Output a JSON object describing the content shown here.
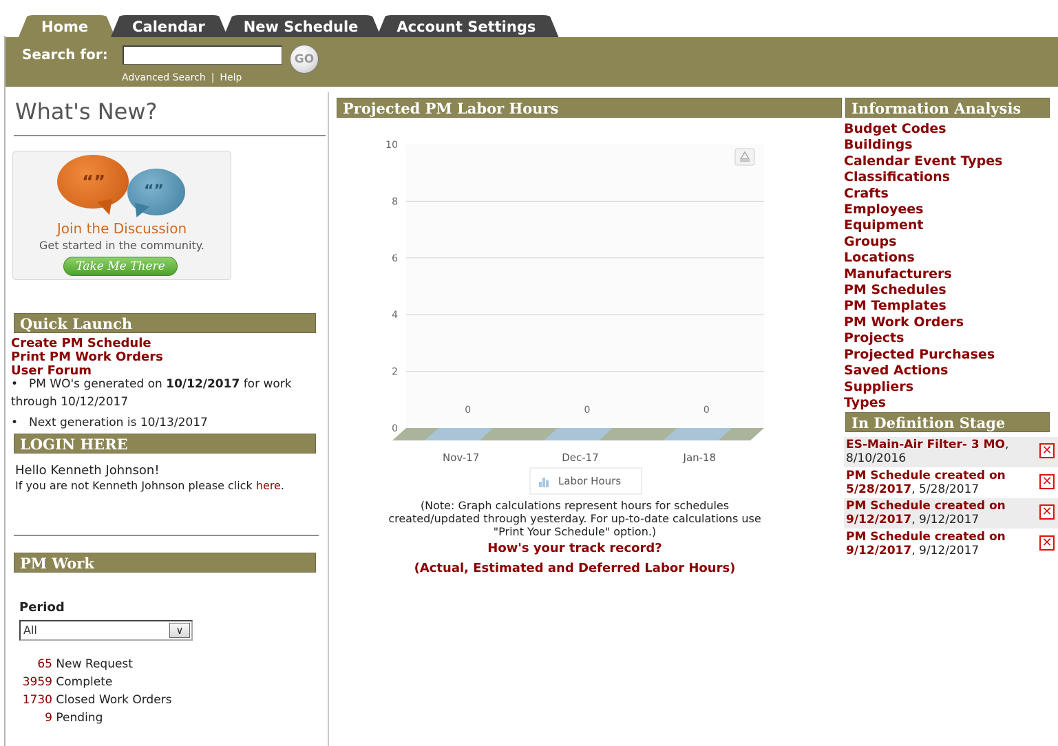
{
  "tabs": [
    "Home",
    "Calendar",
    "New Schedule",
    "Account Settings"
  ],
  "search": {
    "label": "Search for:",
    "value": "",
    "go": "GO",
    "advanced": "Advanced Search",
    "separator": "|",
    "help": "Help"
  },
  "whats_new": {
    "title": "What's New?",
    "promo_title": "Join the Discussion",
    "promo_sub": "Get started in the community.",
    "promo_button": "Take Me There"
  },
  "quick_launch": {
    "title": "Quick Launch",
    "links": [
      "Create PM Schedule",
      "Print PM Work Orders",
      "User Forum"
    ],
    "gen_prefix": "PM WO's generated on ",
    "gen_date": "10/12/2017",
    "gen_suffix": " for work through 10/12/2017",
    "next_gen": "Next generation is 10/13/2017"
  },
  "login": {
    "title": "LOGIN HERE",
    "hello": "Hello Kenneth Johnson!",
    "not_user": "If you are not Kenneth Johnson please click ",
    "here": "here",
    "period": "."
  },
  "pm_work": {
    "title": "PM Work",
    "period_label": "Period",
    "period_value": "All",
    "rows": [
      {
        "num": "65",
        "label": "New Request"
      },
      {
        "num": "3959",
        "label": "Complete"
      },
      {
        "num": "1730",
        "label": "Closed Work Orders"
      },
      {
        "num": "9",
        "label": "Pending"
      }
    ]
  },
  "projected": {
    "title": "Projected PM Labor Hours",
    "note_1": "(Note: Graph calculations represent hours for schedules",
    "note_2": "created/updated through yesterday. For up-to-date calculations use",
    "note_3": "\"Print Your Schedule\" option.)",
    "track_1": "How's your track record?",
    "track_2": "(Actual, Estimated and Deferred Labor Hours)"
  },
  "chart_data": {
    "type": "bar",
    "categories": [
      "Nov-17",
      "Dec-17",
      "Jan-18"
    ],
    "series": [
      {
        "name": "Labor Hours",
        "values": [
          0,
          0,
          0
        ]
      }
    ],
    "data_labels": [
      "0",
      "0",
      "0"
    ],
    "ylim": [
      0,
      10
    ],
    "yticks": [
      "0",
      "2",
      "4",
      "6",
      "8",
      "10"
    ],
    "grid": true,
    "legend": "bottom",
    "colors": {
      "bar": "#a8c7e0",
      "floor": "#a9b49a"
    }
  },
  "info_analysis": {
    "title": "Information Analysis",
    "links": [
      "Budget Codes",
      "Buildings",
      "Calendar Event Types",
      "Classifications",
      "Crafts",
      "Employees",
      "Equipment",
      "Groups",
      "Locations",
      "Manufacturers",
      "PM Schedules",
      "PM Templates",
      "PM Work Orders",
      "Projects",
      "Projected Purchases",
      "Saved Actions",
      "Suppliers",
      "Types"
    ]
  },
  "definition_stage": {
    "title": "In Definition Stage",
    "items": [
      {
        "name": "ES-Main-Air Filter- 3 MO",
        "date": "8/10/2016"
      },
      {
        "name": "PM Schedule created on 5/28/2017",
        "date": "5/28/2017"
      },
      {
        "name": "PM Schedule created on 9/12/2017",
        "date": "9/12/2017"
      },
      {
        "name": "PM Schedule created on 9/12/2017",
        "date": "9/12/2017"
      }
    ],
    "delete_glyph": "✕"
  },
  "colors": {
    "brand": "#8b8654",
    "tab_dark": "#454545",
    "link": "#8b0000"
  }
}
